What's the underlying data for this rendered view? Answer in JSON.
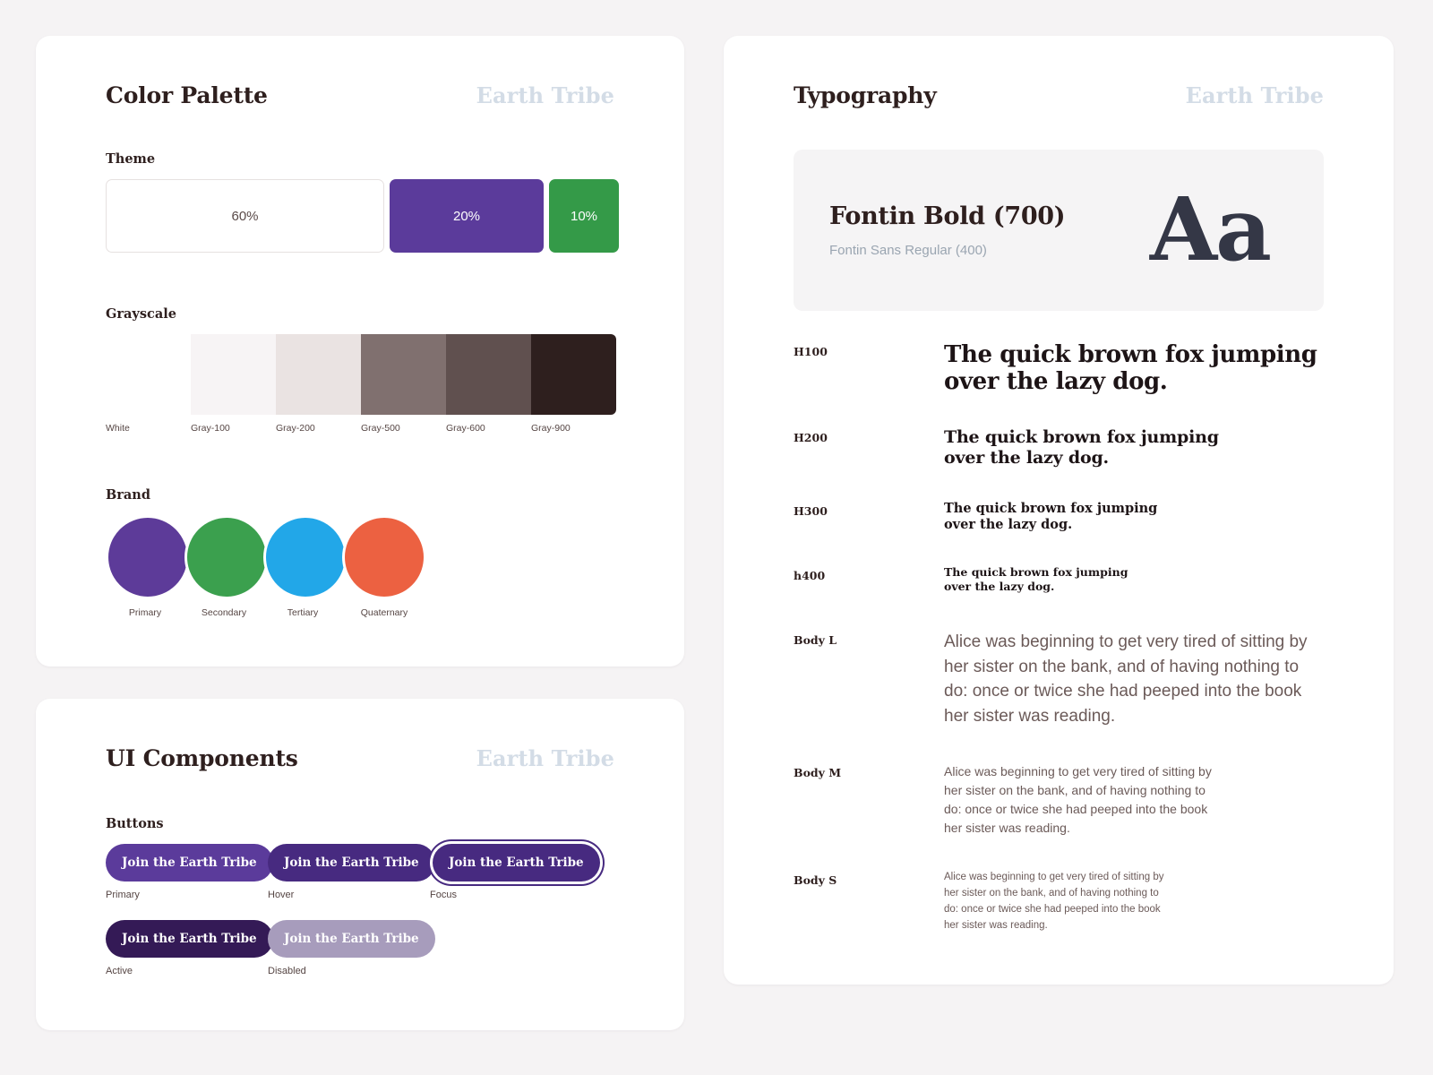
{
  "brand_watermark": "Earth Tribe",
  "palette": {
    "title": "Color Palette",
    "theme": {
      "label": "Theme",
      "swatches": [
        {
          "pct": "60%",
          "color": "#FFFFFF"
        },
        {
          "pct": "20%",
          "color": "#5B3B9B"
        },
        {
          "pct": "10%",
          "color": "#349A48"
        }
      ]
    },
    "grayscale": {
      "label": "Grayscale",
      "swatches": [
        {
          "name": "White",
          "color": "#FFFFFF"
        },
        {
          "name": "Gray-100",
          "color": "#F7F4F5"
        },
        {
          "name": "Gray-200",
          "color": "#EAE3E2"
        },
        {
          "name": "Gray-500",
          "color": "#80706F"
        },
        {
          "name": "Gray-600",
          "color": "#60504F"
        },
        {
          "name": "Gray-900",
          "color": "#2E1F1E"
        }
      ]
    },
    "brand": {
      "label": "Brand",
      "swatches": [
        {
          "name": "Primary",
          "color": "#5D3B99"
        },
        {
          "name": "Secondary",
          "color": "#3BA04E"
        },
        {
          "name": "Tertiary",
          "color": "#22A7E8"
        },
        {
          "name": "Quaternary",
          "color": "#EC6141"
        }
      ]
    }
  },
  "components": {
    "title": "UI Components",
    "buttons_label": "Buttons",
    "buttons": [
      {
        "label": "Join the Earth Tribe",
        "state": "Primary"
      },
      {
        "label": "Join the Earth Tribe",
        "state": "Hover"
      },
      {
        "label": "Join the Earth Tribe",
        "state": "Focus"
      },
      {
        "label": "Join the Earth Tribe",
        "state": "Active"
      },
      {
        "label": "Join the Earth Tribe",
        "state": "Disabled"
      }
    ]
  },
  "typography": {
    "title": "Typography",
    "specimen": {
      "primary": "Fontin Bold (700)",
      "secondary": "Fontin Sans Regular (400)",
      "glyphs": "Aa"
    },
    "scale": [
      {
        "key": "H100",
        "text": "The quick brown fox jumping\nover the lazy dog."
      },
      {
        "key": "H200",
        "text": "The quick brown fox jumping\nover the lazy dog."
      },
      {
        "key": "H300",
        "text": "The quick brown fox jumping\nover the lazy dog."
      },
      {
        "key": "h400",
        "text": "The quick brown fox jumping\nover the lazy dog."
      },
      {
        "key": "Body L",
        "text": "Alice was beginning to get very tired of sitting by her sister on the bank, and of having nothing to do: once or twice she had peeped into the book her sister was reading."
      },
      {
        "key": "Body M",
        "text": "Alice was beginning to get very tired of sitting by\nher sister on the bank, and of having nothing to\ndo: once or twice she had peeped into the book\nher sister was reading."
      },
      {
        "key": "Body S",
        "text": "Alice was beginning to get very tired of sitting by\nher sister on the bank, and of having nothing to\ndo: once or twice she had peeped into the book\nher sister was reading."
      }
    ]
  }
}
